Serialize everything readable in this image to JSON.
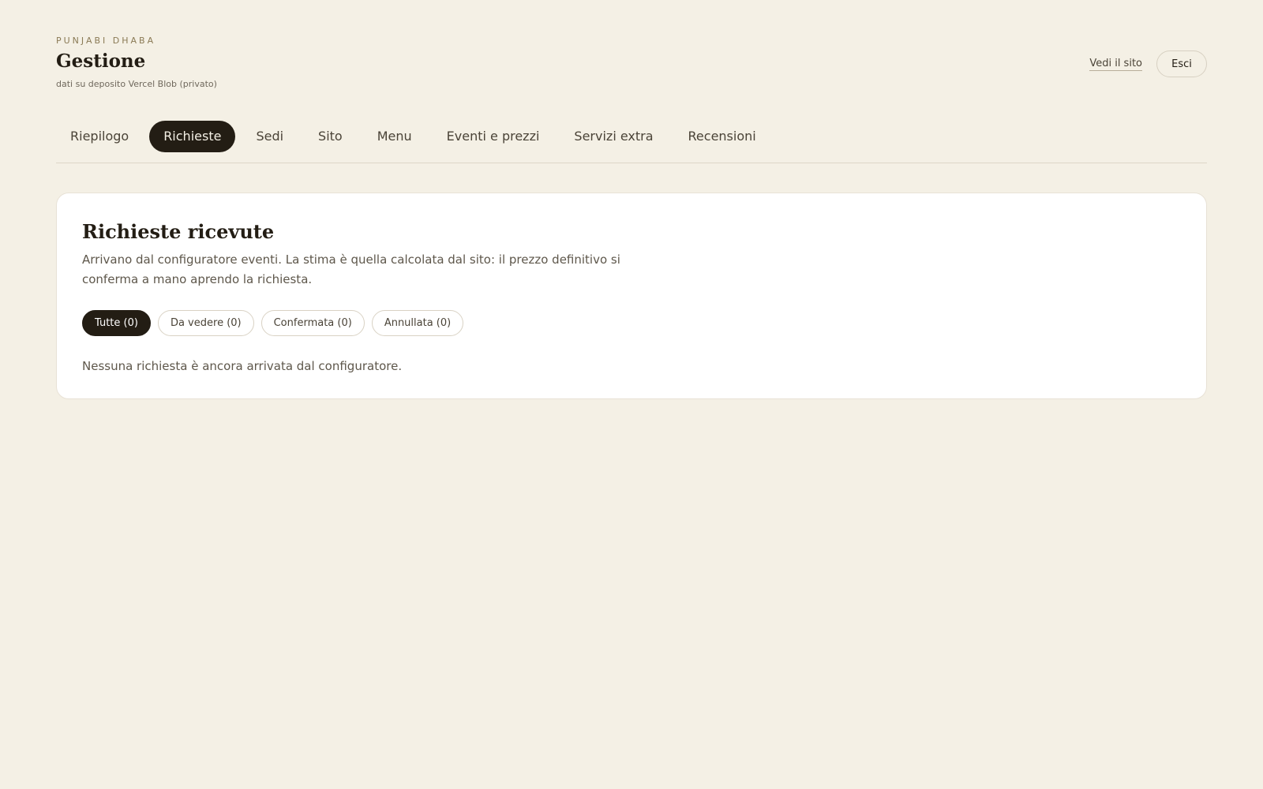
{
  "header": {
    "brand": "PUNJABI DHABA",
    "title": "Gestione",
    "subtitle": "dati su deposito Vercel Blob (privato)",
    "view_site_label": "Vedi il sito",
    "logout_label": "Esci"
  },
  "tabs": [
    {
      "label": "Riepilogo",
      "active": false
    },
    {
      "label": "Richieste",
      "active": true
    },
    {
      "label": "Sedi",
      "active": false
    },
    {
      "label": "Sito",
      "active": false
    },
    {
      "label": "Menu",
      "active": false
    },
    {
      "label": "Eventi e prezzi",
      "active": false
    },
    {
      "label": "Servizi extra",
      "active": false
    },
    {
      "label": "Recensioni",
      "active": false
    }
  ],
  "requests": {
    "title": "Richieste ricevute",
    "description": "Arrivano dal configuratore eventi. La stima è quella calcolata dal sito: il prezzo definitivo si conferma a mano aprendo la richiesta.",
    "filters": [
      {
        "label": "Tutte (0)",
        "active": true
      },
      {
        "label": "Da vedere (0)",
        "active": false
      },
      {
        "label": "Confermata (0)",
        "active": false
      },
      {
        "label": "Annullata (0)",
        "active": false
      }
    ],
    "empty_message": "Nessuna richiesta è ancora arrivata dal configuratore."
  },
  "colors": {
    "background": "#f4f0e5",
    "accent_dark": "#231d14",
    "card": "#ffffff"
  }
}
